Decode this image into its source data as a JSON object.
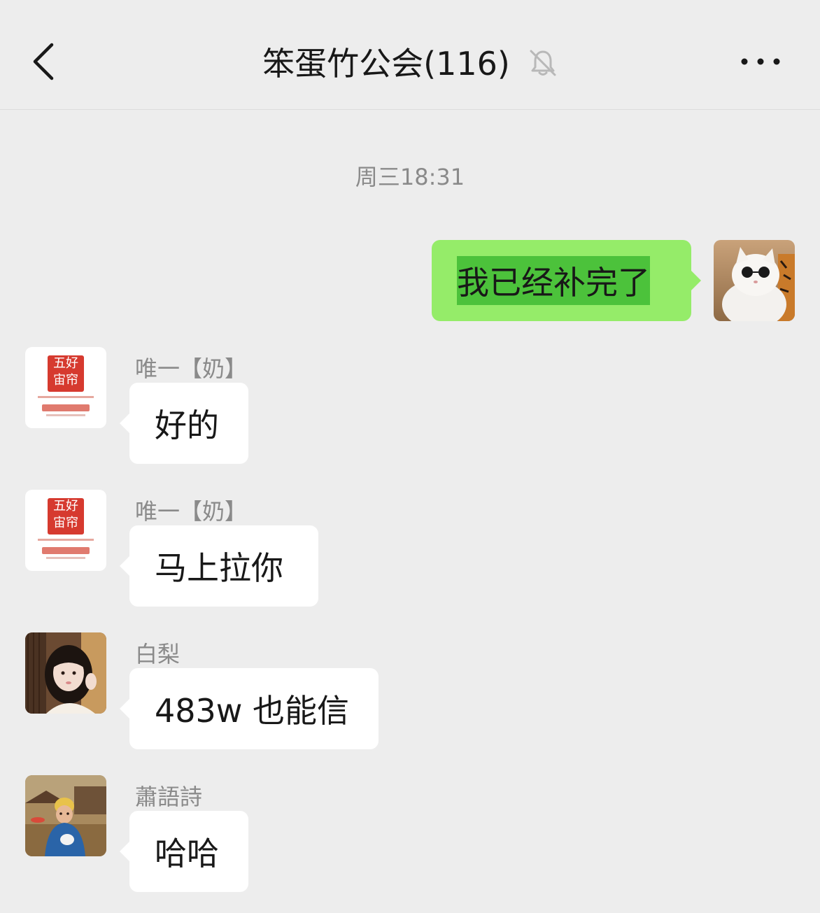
{
  "header": {
    "title": "笨蛋竹公会(116)",
    "muted": true
  },
  "chat": {
    "timestamp": "周三18:31",
    "messages": [
      {
        "direction": "out",
        "text": "我已经补完了",
        "avatar": "white-cat-sunglasses-avatar"
      },
      {
        "direction": "in",
        "sender": "唯一【奶】",
        "text": "好的",
        "avatar": "shop-logo-avatar"
      },
      {
        "direction": "in",
        "sender": "唯一【奶】",
        "text": "马上拉你",
        "avatar": "shop-logo-avatar"
      },
      {
        "direction": "in",
        "sender": "白梨",
        "text": "483w 也能信",
        "avatar": "girl-photo-avatar"
      },
      {
        "direction": "in",
        "sender": "蕭語詩",
        "text": "哈哈",
        "avatar": "child-photo-avatar"
      }
    ]
  },
  "colors": {
    "background": "#ededed",
    "outgoing_bubble": "#95ec69",
    "selection": "#4cc23b",
    "incoming_bubble": "#ffffff",
    "logo_seal": "#d63a2f"
  }
}
